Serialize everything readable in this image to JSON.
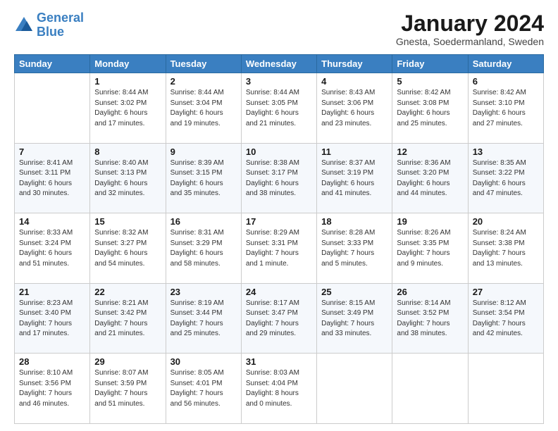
{
  "header": {
    "logo_line1": "General",
    "logo_line2": "Blue",
    "title": "January 2024",
    "subtitle": "Gnesta, Soedermanland, Sweden"
  },
  "weekdays": [
    "Sunday",
    "Monday",
    "Tuesday",
    "Wednesday",
    "Thursday",
    "Friday",
    "Saturday"
  ],
  "weeks": [
    [
      {
        "day": "",
        "sunrise": "",
        "sunset": "",
        "daylight": ""
      },
      {
        "day": "1",
        "sunrise": "Sunrise: 8:44 AM",
        "sunset": "Sunset: 3:02 PM",
        "daylight": "Daylight: 6 hours and 17 minutes."
      },
      {
        "day": "2",
        "sunrise": "Sunrise: 8:44 AM",
        "sunset": "Sunset: 3:04 PM",
        "daylight": "Daylight: 6 hours and 19 minutes."
      },
      {
        "day": "3",
        "sunrise": "Sunrise: 8:44 AM",
        "sunset": "Sunset: 3:05 PM",
        "daylight": "Daylight: 6 hours and 21 minutes."
      },
      {
        "day": "4",
        "sunrise": "Sunrise: 8:43 AM",
        "sunset": "Sunset: 3:06 PM",
        "daylight": "Daylight: 6 hours and 23 minutes."
      },
      {
        "day": "5",
        "sunrise": "Sunrise: 8:42 AM",
        "sunset": "Sunset: 3:08 PM",
        "daylight": "Daylight: 6 hours and 25 minutes."
      },
      {
        "day": "6",
        "sunrise": "Sunrise: 8:42 AM",
        "sunset": "Sunset: 3:10 PM",
        "daylight": "Daylight: 6 hours and 27 minutes."
      }
    ],
    [
      {
        "day": "7",
        "sunrise": "Sunrise: 8:41 AM",
        "sunset": "Sunset: 3:11 PM",
        "daylight": "Daylight: 6 hours and 30 minutes."
      },
      {
        "day": "8",
        "sunrise": "Sunrise: 8:40 AM",
        "sunset": "Sunset: 3:13 PM",
        "daylight": "Daylight: 6 hours and 32 minutes."
      },
      {
        "day": "9",
        "sunrise": "Sunrise: 8:39 AM",
        "sunset": "Sunset: 3:15 PM",
        "daylight": "Daylight: 6 hours and 35 minutes."
      },
      {
        "day": "10",
        "sunrise": "Sunrise: 8:38 AM",
        "sunset": "Sunset: 3:17 PM",
        "daylight": "Daylight: 6 hours and 38 minutes."
      },
      {
        "day": "11",
        "sunrise": "Sunrise: 8:37 AM",
        "sunset": "Sunset: 3:19 PM",
        "daylight": "Daylight: 6 hours and 41 minutes."
      },
      {
        "day": "12",
        "sunrise": "Sunrise: 8:36 AM",
        "sunset": "Sunset: 3:20 PM",
        "daylight": "Daylight: 6 hours and 44 minutes."
      },
      {
        "day": "13",
        "sunrise": "Sunrise: 8:35 AM",
        "sunset": "Sunset: 3:22 PM",
        "daylight": "Daylight: 6 hours and 47 minutes."
      }
    ],
    [
      {
        "day": "14",
        "sunrise": "Sunrise: 8:33 AM",
        "sunset": "Sunset: 3:24 PM",
        "daylight": "Daylight: 6 hours and 51 minutes."
      },
      {
        "day": "15",
        "sunrise": "Sunrise: 8:32 AM",
        "sunset": "Sunset: 3:27 PM",
        "daylight": "Daylight: 6 hours and 54 minutes."
      },
      {
        "day": "16",
        "sunrise": "Sunrise: 8:31 AM",
        "sunset": "Sunset: 3:29 PM",
        "daylight": "Daylight: 6 hours and 58 minutes."
      },
      {
        "day": "17",
        "sunrise": "Sunrise: 8:29 AM",
        "sunset": "Sunset: 3:31 PM",
        "daylight": "Daylight: 7 hours and 1 minute."
      },
      {
        "day": "18",
        "sunrise": "Sunrise: 8:28 AM",
        "sunset": "Sunset: 3:33 PM",
        "daylight": "Daylight: 7 hours and 5 minutes."
      },
      {
        "day": "19",
        "sunrise": "Sunrise: 8:26 AM",
        "sunset": "Sunset: 3:35 PM",
        "daylight": "Daylight: 7 hours and 9 minutes."
      },
      {
        "day": "20",
        "sunrise": "Sunrise: 8:24 AM",
        "sunset": "Sunset: 3:38 PM",
        "daylight": "Daylight: 7 hours and 13 minutes."
      }
    ],
    [
      {
        "day": "21",
        "sunrise": "Sunrise: 8:23 AM",
        "sunset": "Sunset: 3:40 PM",
        "daylight": "Daylight: 7 hours and 17 minutes."
      },
      {
        "day": "22",
        "sunrise": "Sunrise: 8:21 AM",
        "sunset": "Sunset: 3:42 PM",
        "daylight": "Daylight: 7 hours and 21 minutes."
      },
      {
        "day": "23",
        "sunrise": "Sunrise: 8:19 AM",
        "sunset": "Sunset: 3:44 PM",
        "daylight": "Daylight: 7 hours and 25 minutes."
      },
      {
        "day": "24",
        "sunrise": "Sunrise: 8:17 AM",
        "sunset": "Sunset: 3:47 PM",
        "daylight": "Daylight: 7 hours and 29 minutes."
      },
      {
        "day": "25",
        "sunrise": "Sunrise: 8:15 AM",
        "sunset": "Sunset: 3:49 PM",
        "daylight": "Daylight: 7 hours and 33 minutes."
      },
      {
        "day": "26",
        "sunrise": "Sunrise: 8:14 AM",
        "sunset": "Sunset: 3:52 PM",
        "daylight": "Daylight: 7 hours and 38 minutes."
      },
      {
        "day": "27",
        "sunrise": "Sunrise: 8:12 AM",
        "sunset": "Sunset: 3:54 PM",
        "daylight": "Daylight: 7 hours and 42 minutes."
      }
    ],
    [
      {
        "day": "28",
        "sunrise": "Sunrise: 8:10 AM",
        "sunset": "Sunset: 3:56 PM",
        "daylight": "Daylight: 7 hours and 46 minutes."
      },
      {
        "day": "29",
        "sunrise": "Sunrise: 8:07 AM",
        "sunset": "Sunset: 3:59 PM",
        "daylight": "Daylight: 7 hours and 51 minutes."
      },
      {
        "day": "30",
        "sunrise": "Sunrise: 8:05 AM",
        "sunset": "Sunset: 4:01 PM",
        "daylight": "Daylight: 7 hours and 56 minutes."
      },
      {
        "day": "31",
        "sunrise": "Sunrise: 8:03 AM",
        "sunset": "Sunset: 4:04 PM",
        "daylight": "Daylight: 8 hours and 0 minutes."
      },
      {
        "day": "",
        "sunrise": "",
        "sunset": "",
        "daylight": ""
      },
      {
        "day": "",
        "sunrise": "",
        "sunset": "",
        "daylight": ""
      },
      {
        "day": "",
        "sunrise": "",
        "sunset": "",
        "daylight": ""
      }
    ]
  ]
}
